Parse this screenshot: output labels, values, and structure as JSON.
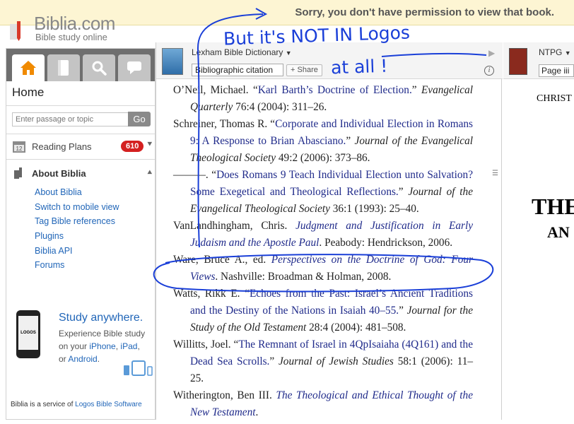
{
  "banner": {
    "message": "Sorry, you don't have permission to view that book."
  },
  "brand": {
    "logo_text": "Biblia.com",
    "tagline": "Bible study online"
  },
  "sidebar": {
    "home_title": "Home",
    "search_placeholder": "Enter passage or topic",
    "go_label": "Go",
    "reading_plans": {
      "label": "Reading Plans",
      "count": "610"
    },
    "about": {
      "label": "About Biblia",
      "links": [
        "About Biblia",
        "Switch to mobile view",
        "Tag Bible references",
        "Plugins",
        "Biblia API",
        "Forums"
      ]
    },
    "study": {
      "title": "Study anywhere.",
      "line1": "Experience Bible study",
      "line2_prefix": "on your ",
      "iphone": "iPhone",
      "comma": ", ",
      "ipad": "iPad",
      "comma2": ",",
      "line3_prefix": "or ",
      "android": "Android",
      "period": ".",
      "phone_brand": "LOGOS"
    },
    "footer": {
      "prefix": "Biblia is a service of ",
      "link": "Logos Bible Software"
    }
  },
  "center": {
    "resource_title": "Lexham Bible Dictionary",
    "section_select": "Bibliographic citation",
    "share_label": "Share",
    "entries": [
      {
        "parts": [
          {
            "t": "O’Neil, Michael. “"
          },
          {
            "t": "Karl Barth’s Doctrine of Election.",
            "c": "lnk"
          },
          {
            "t": "” "
          },
          {
            "t": "Evangelical Quarterly",
            "c": "ital"
          },
          {
            "t": " 76:4 (2004): 311–26."
          }
        ]
      },
      {
        "parts": [
          {
            "t": "Schreiner, Thomas R. “"
          },
          {
            "t": "Corporate and Individual Election in Romans 9: A Response to Brian Abasciano.",
            "c": "lnk"
          },
          {
            "t": "” "
          },
          {
            "t": "Journal of the Evangelical Theological Society",
            "c": "ital"
          },
          {
            "t": " 49:2 (2006): 373–86."
          }
        ]
      },
      {
        "parts": [
          {
            "t": "———. “"
          },
          {
            "t": "Does Romans 9 Teach Individual Election unto Salvation? Some Exegetical and Theological Reflections.",
            "c": "lnk"
          },
          {
            "t": "” "
          },
          {
            "t": "Journal of the Evangelical Theological Society",
            "c": "ital"
          },
          {
            "t": " 36:1 (1993): 25–40."
          }
        ]
      },
      {
        "parts": [
          {
            "t": "VanLandhingham, Chris. "
          },
          {
            "t": "Judgment and Justification in Early Judaism and the Apostle Paul",
            "c": "lnk ital"
          },
          {
            "t": ". Peabody: Hendrickson, 2006."
          }
        ]
      },
      {
        "parts": [
          {
            "t": "Ware, Bruce A., ed. "
          },
          {
            "t": "Perspectives on the Doctrine of God: Four Views",
            "c": "lnk ital"
          },
          {
            "t": ". Nashville: Broadman & Holman, 2008."
          }
        ]
      },
      {
        "parts": [
          {
            "t": "Watts, Rikk E. “"
          },
          {
            "t": "Echoes from the Past: Israel’s Ancient Traditions and the Destiny of the Nations in Isaiah 40–55.",
            "c": "lnk"
          },
          {
            "t": "” "
          },
          {
            "t": "Journal for the Study of the Old Testament",
            "c": "ital"
          },
          {
            "t": " 28:4 (2004): 481–508."
          }
        ]
      },
      {
        "parts": [
          {
            "t": "Willitts, Joel. “"
          },
          {
            "t": "The Remnant of Israel in 4QpIsaiaha (4Q161) and the Dead Sea Scrolls.",
            "c": "lnk"
          },
          {
            "t": "” "
          },
          {
            "t": "Journal of Jewish Studies",
            "c": "ital"
          },
          {
            "t": " 58:1 (2006): 11–25."
          }
        ]
      },
      {
        "parts": [
          {
            "t": "Witherington, Ben III. "
          },
          {
            "t": "The Theological and Ethical Thought of the New Testament",
            "c": "lnk ital"
          },
          {
            "t": ". "
          }
        ]
      }
    ]
  },
  "right": {
    "resource_title": "NTPG",
    "page_select": "Page iii",
    "heading_small": "CHRIST",
    "heading_big": "THE",
    "heading_mid": "AN"
  },
  "annotation": {
    "line1": "But it's NOT IN Logos",
    "line2": "at all !",
    "color": "#1a3fd8"
  }
}
